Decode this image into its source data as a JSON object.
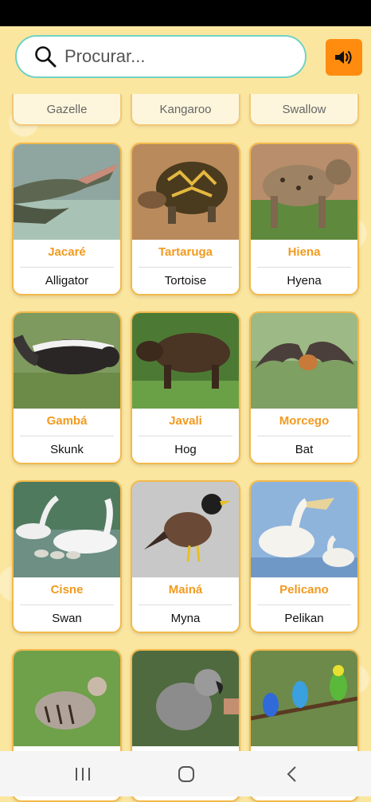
{
  "search": {
    "placeholder": "Procurar..."
  },
  "sound_button": {
    "icon": "speaker-icon",
    "color": "#ff8c0f"
  },
  "partial_row": [
    "Gazelle",
    "Kangaroo",
    "Swallow"
  ],
  "animals": [
    {
      "pt": "Jacaré",
      "en": "Alligator"
    },
    {
      "pt": "Tartaruga",
      "en": "Tortoise"
    },
    {
      "pt": "Hiena",
      "en": "Hyena"
    },
    {
      "pt": "Gambá",
      "en": "Skunk"
    },
    {
      "pt": "Javali",
      "en": "Hog"
    },
    {
      "pt": "Morcego",
      "en": "Bat"
    },
    {
      "pt": "Cisne",
      "en": "Swan"
    },
    {
      "pt": "Mainá",
      "en": "Myna"
    },
    {
      "pt": "Pelicano",
      "en": "Pelikan"
    },
    {
      "pt": "",
      "en": ""
    },
    {
      "pt": "",
      "en": ""
    },
    {
      "pt": "",
      "en": ""
    }
  ],
  "colors": {
    "accent": "#f29a1f",
    "card_border": "#f3b94a",
    "search_border": "#6fd3c4",
    "background": "#fbe6a0"
  },
  "nav": {
    "recent": "recent-apps-icon",
    "home": "home-icon",
    "back": "back-icon"
  }
}
